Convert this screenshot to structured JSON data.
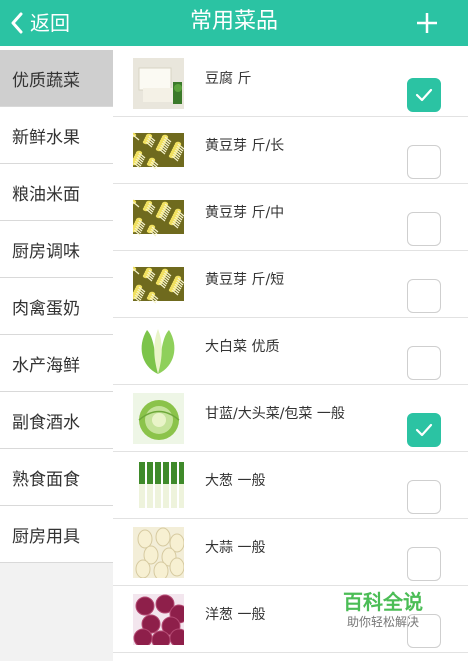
{
  "header": {
    "back_label": "返回",
    "title": "常用菜品"
  },
  "colors": {
    "accent": "#2bc3a3",
    "sidebar_active": "#cfcfcf"
  },
  "sidebar": {
    "items": [
      {
        "label": "优质蔬菜",
        "active": true
      },
      {
        "label": "新鲜水果"
      },
      {
        "label": "粮油米面"
      },
      {
        "label": "厨房调味"
      },
      {
        "label": "肉禽蛋奶"
      },
      {
        "label": "水产海鲜"
      },
      {
        "label": "副食酒水"
      },
      {
        "label": "熟食面食"
      },
      {
        "label": "厨房用具"
      }
    ]
  },
  "items": [
    {
      "name": "豆腐 斤",
      "checked": true,
      "icon": "tofu"
    },
    {
      "name": "黄豆芽 斤/长",
      "checked": false,
      "icon": "bean-sprouts"
    },
    {
      "name": "黄豆芽 斤/中",
      "checked": false,
      "icon": "bean-sprouts"
    },
    {
      "name": "黄豆芽 斤/短",
      "checked": false,
      "icon": "bean-sprouts"
    },
    {
      "name": "大白菜 优质",
      "checked": false,
      "icon": "napa-cabbage"
    },
    {
      "name": "甘蓝/大头菜/包菜 一般",
      "checked": true,
      "icon": "cabbage"
    },
    {
      "name": "大葱 一般",
      "checked": false,
      "icon": "scallion"
    },
    {
      "name": "大蒜 一般",
      "checked": false,
      "icon": "garlic"
    },
    {
      "name": "洋葱 一般",
      "checked": false,
      "icon": "onion"
    }
  ],
  "watermark": {
    "title": "百科全说",
    "subtitle": "助你轻松解决"
  }
}
